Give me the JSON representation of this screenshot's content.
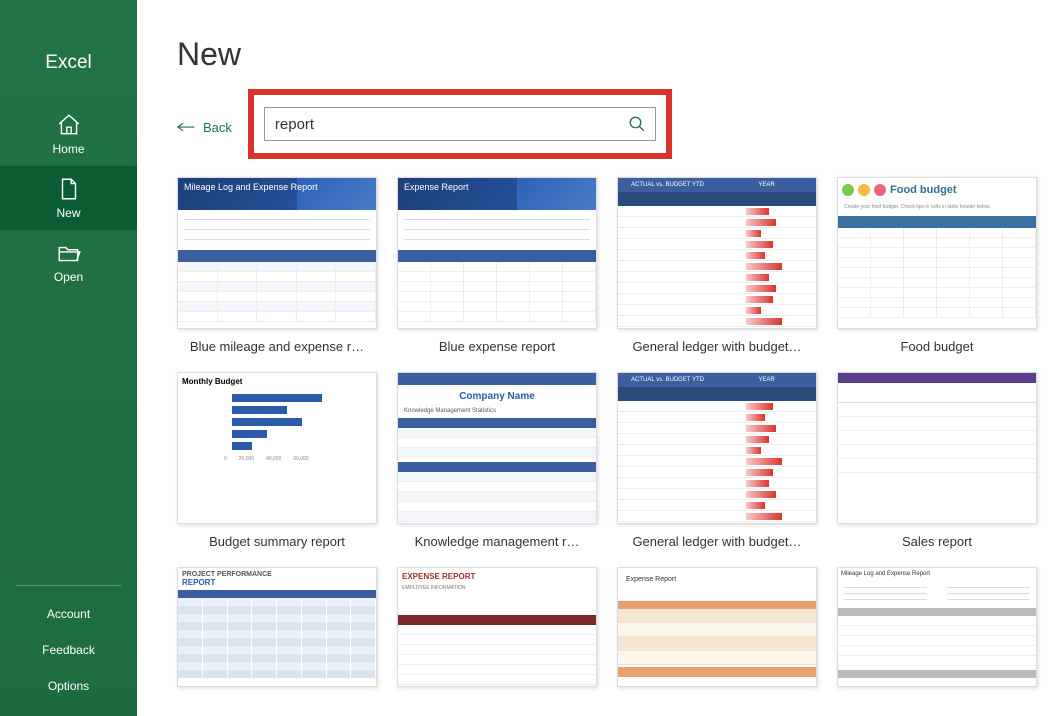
{
  "app_name": "Excel",
  "sidebar": {
    "brand": "Excel",
    "items": [
      {
        "key": "home",
        "label": "Home"
      },
      {
        "key": "new",
        "label": "New"
      },
      {
        "key": "open",
        "label": "Open"
      }
    ],
    "bottom": [
      {
        "key": "account",
        "label": "Account"
      },
      {
        "key": "feedback",
        "label": "Feedback"
      },
      {
        "key": "options",
        "label": "Options"
      }
    ]
  },
  "page": {
    "title": "New",
    "back_label": "Back"
  },
  "search": {
    "value": "report"
  },
  "templates": [
    {
      "key": "blue-mileage",
      "label": "Blue mileage and expense r…"
    },
    {
      "key": "blue-expense",
      "label": "Blue expense report"
    },
    {
      "key": "ledger-1",
      "label": "General ledger with budget…"
    },
    {
      "key": "food-budget",
      "label": "Food budget"
    },
    {
      "key": "budget-summary",
      "label": "Budget summary report"
    },
    {
      "key": "knowledge-mgmt",
      "label": "Knowledge management r…"
    },
    {
      "key": "ledger-2",
      "label": "General ledger with budget…"
    },
    {
      "key": "sales-report",
      "label": "Sales report"
    },
    {
      "key": "project-perf",
      "label": ""
    },
    {
      "key": "expense-red",
      "label": ""
    },
    {
      "key": "expense-peach",
      "label": ""
    },
    {
      "key": "mileage-plain",
      "label": ""
    }
  ],
  "thumb_text": {
    "blue_mileage_title": "Mileage Log and Expense Report",
    "blue_expense_title": "Expense Report",
    "ledger_actual": "ACTUAL vs. BUDGET YTD",
    "ledger_year": "YEAR",
    "food_title": "Food budget",
    "budget_title": "Monthly Budget",
    "km_company": "Company Name",
    "km_sub": "Knowledge Management Statistics",
    "perf_line1": "PROJECT PERFORMANCE",
    "perf_line2": "REPORT",
    "exp2_title": "EXPENSE REPORT",
    "exp2_sub": "EMPLOYEE INFORMATION",
    "exp3_title": "Expense Report",
    "mil_title": "Mileage Log and Expense Report"
  }
}
